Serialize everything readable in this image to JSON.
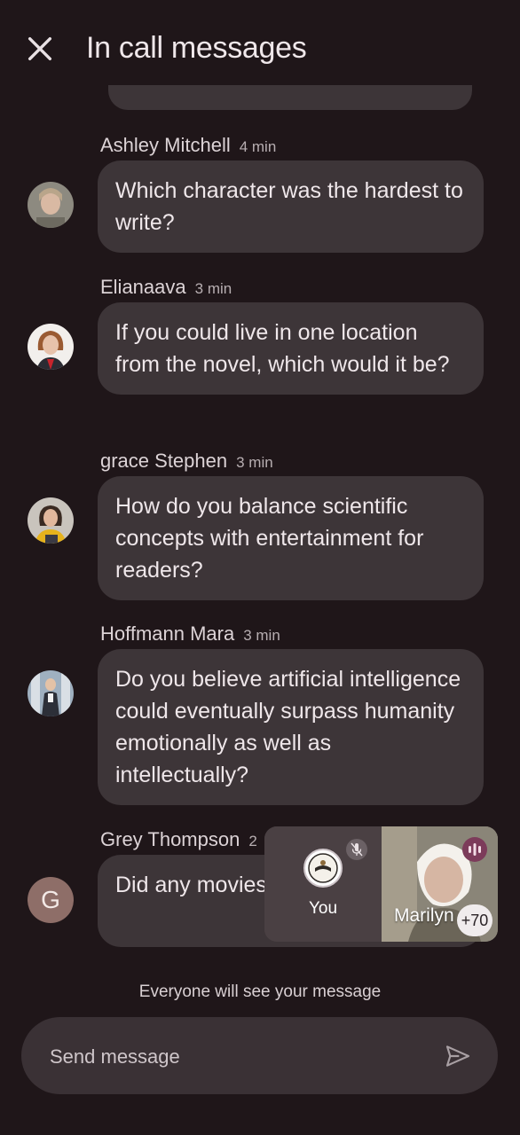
{
  "header": {
    "title": "In call messages",
    "close_icon": "close-icon"
  },
  "messages": [
    {
      "name": "Ashley Mitchell",
      "time": "4 min",
      "text": "Which character was the hardest to write?",
      "avatar": "photo"
    },
    {
      "name": "Elianaava",
      "time": "3 min",
      "text": "If you could live in one location from the novel, which would it be?",
      "avatar": "photo"
    },
    {
      "name": "grace Stephen",
      "time": "3 min",
      "text": "How do you balance scientific concepts with entertainment for readers?",
      "avatar": "photo"
    },
    {
      "name": "Hoffmann Mara",
      "time": "3 min",
      "text": "Do you believe artificial intelligence could eventually surpass humanity emotionally as well as intellectually?",
      "avatar": "photo"
    },
    {
      "name": "Grey Thompson",
      "time": "2",
      "text": "Did any movies influence your",
      "avatar_letter": "G"
    }
  ],
  "notice": "Everyone will see your message",
  "composer": {
    "placeholder": "Send message",
    "send_icon": "send-icon"
  },
  "call_preview": {
    "self_label": "You",
    "other_label": "Marilyn",
    "participant_count": "+70",
    "mic_status_icon": "mic-off-icon",
    "speaking_icon": "speaking-icon"
  },
  "colors": {
    "background": "#1f1619",
    "bubble": "#3d3538",
    "composer": "#3a3135",
    "grey_avatar": "#8e6e68"
  }
}
